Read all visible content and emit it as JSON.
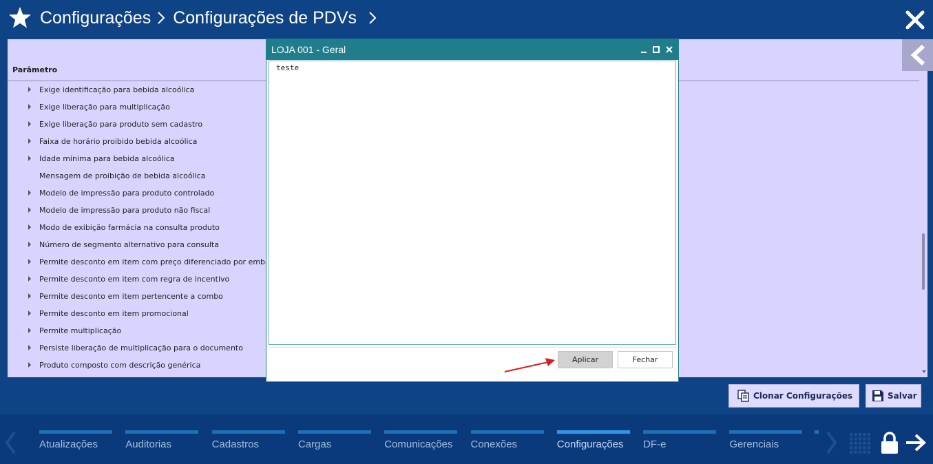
{
  "header": {
    "breadcrumb": [
      "Configurações",
      "Configurações de PDVs"
    ],
    "icons": {
      "left": "star-icon",
      "right": "close-icon"
    }
  },
  "panel": {
    "column_header": "Parâmetro",
    "items": [
      {
        "label": "Exige identificação para bebida alcoólica",
        "expandable": true
      },
      {
        "label": "Exige liberação para multiplicação",
        "expandable": true
      },
      {
        "label": "Exige liberação para produto sem cadastro",
        "expandable": true
      },
      {
        "label": "Faixa de horário proibido bebida alcoólica",
        "expandable": true
      },
      {
        "label": "Idade mínima para bebida alcoólica",
        "expandable": true
      },
      {
        "label": "Mensagem de proibição de bebida alcoólica",
        "expandable": false
      },
      {
        "label": "Modelo de impressão para produto controlado",
        "expandable": true
      },
      {
        "label": "Modelo de impressão para produto não fiscal",
        "expandable": true
      },
      {
        "label": "Modo de exibição farmácia na consulta produto",
        "expandable": true
      },
      {
        "label": "Número de segmento alternativo para consulta",
        "expandable": true
      },
      {
        "label": "Permite desconto em item com preço diferenciado por embalagem",
        "expandable": true
      },
      {
        "label": "Permite desconto em item com regra de incentivo",
        "expandable": true
      },
      {
        "label": "Permite desconto em item pertencente a combo",
        "expandable": true
      },
      {
        "label": "Permite desconto em item promocional",
        "expandable": true
      },
      {
        "label": "Permite multiplicação",
        "expandable": true
      },
      {
        "label": "Persiste liberação de multiplicação para o documento",
        "expandable": true
      },
      {
        "label": "Produto composto com descrição genérica",
        "expandable": true
      }
    ]
  },
  "actions": {
    "clone_label": "Clonar Configurações",
    "save_label": "Salvar"
  },
  "modal": {
    "title": "LOJA 001 - Geral",
    "text_value": "teste",
    "apply_label": "Aplicar",
    "close_label": "Fechar"
  },
  "bottom_nav": {
    "items": [
      {
        "label": "Atualizações",
        "active": false
      },
      {
        "label": "Auditorias",
        "active": false
      },
      {
        "label": "Cadastros",
        "active": false
      },
      {
        "label": "Cargas",
        "active": false
      },
      {
        "label": "Comunicações",
        "active": false
      },
      {
        "label": "Conexões",
        "active": false
      },
      {
        "label": "Configurações",
        "active": true
      },
      {
        "label": "DF-e",
        "active": false
      },
      {
        "label": "Gerenciais",
        "active": false
      }
    ],
    "icons": [
      "chevron-left-icon",
      "chevron-right-icon",
      "grid-icon",
      "lock-icon",
      "exit-arrow-icon"
    ]
  },
  "colors": {
    "background": "#0e4486",
    "panel": "#d8d4ff",
    "modal_title_bar": "#1f7d8c",
    "nav_bar": "#0a3a7c",
    "annotation_arrow": "#d42020"
  }
}
